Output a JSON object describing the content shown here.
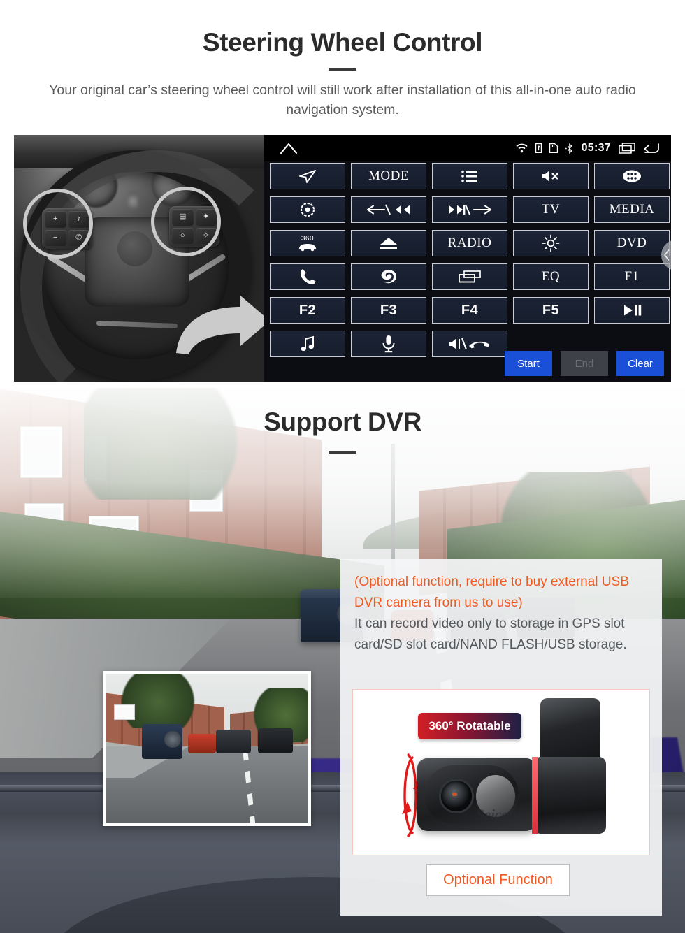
{
  "swc": {
    "title": "Steering Wheel Control",
    "subtitle": "Your original car’s steering wheel control will still work after installation of this all-in-one auto radio navigation system.",
    "status_bar": {
      "home_icon": "home-icon",
      "wifi_icon": "wifi-icon",
      "lock_icon": "lock-icon",
      "sdcard_icon": "sd-card-icon",
      "bluetooth_icon": "bluetooth-icon",
      "clock": "05:37",
      "recents_icon": "recents-icon",
      "back_icon": "back-icon"
    },
    "buttons": [
      {
        "label": "",
        "icon": "navigation-arrow-icon"
      },
      {
        "label": "MODE",
        "icon": ""
      },
      {
        "label": "",
        "icon": "list-icon"
      },
      {
        "label": "",
        "icon": "mute-icon"
      },
      {
        "label": "",
        "icon": "app-drawer-icon"
      },
      {
        "label": "",
        "icon": "target-icon"
      },
      {
        "label": "",
        "icon": "previous-track-icon"
      },
      {
        "label": "",
        "icon": "next-track-icon"
      },
      {
        "label": "TV",
        "icon": ""
      },
      {
        "label": "MEDIA",
        "icon": ""
      },
      {
        "label": "",
        "icon": "360-camera-icon"
      },
      {
        "label": "",
        "icon": "eject-icon"
      },
      {
        "label": "RADIO",
        "icon": ""
      },
      {
        "label": "",
        "icon": "brightness-icon"
      },
      {
        "label": "DVD",
        "icon": ""
      },
      {
        "label": "",
        "icon": "phone-icon"
      },
      {
        "label": "",
        "icon": "swirl-icon"
      },
      {
        "label": "",
        "icon": "screen-icon"
      },
      {
        "label": "EQ",
        "icon": ""
      },
      {
        "label": "F1",
        "icon": ""
      },
      {
        "label": "F2",
        "icon": ""
      },
      {
        "label": "F3",
        "icon": ""
      },
      {
        "label": "F4",
        "icon": ""
      },
      {
        "label": "F5",
        "icon": ""
      },
      {
        "label": "",
        "icon": "play-pause-icon"
      },
      {
        "label": "",
        "icon": "music-note-icon"
      },
      {
        "label": "",
        "icon": "microphone-icon"
      },
      {
        "label": "",
        "icon": "volume-hangup-icon"
      }
    ],
    "actions": {
      "start": "Start",
      "end": "End",
      "clear": "Clear"
    },
    "wheel_keys": {
      "left": [
        "+",
        "♪",
        "−",
        "✆"
      ],
      "right": [
        "▤",
        "✦",
        "○",
        "✧"
      ]
    },
    "colors": {
      "highlight": "#f5cf1e",
      "action_blue": "#1a50d8",
      "panel_bg": "#0b0d12"
    }
  },
  "dvr": {
    "title": "Support DVR",
    "note_orange": "(Optional function, require to buy external USB DVR camera from us to use)",
    "note_gray": "It can record video only to storage in GPS slot card/SD slot card/NAND FLASH/USB storage.",
    "rotatable_badge": "360° Rotatable",
    "camera_brand": "Seicane",
    "optional_button": "Optional Function",
    "colors": {
      "orange": "#f05a22",
      "badge_red": "#d21f25",
      "badge_navy": "#1d2145"
    }
  }
}
